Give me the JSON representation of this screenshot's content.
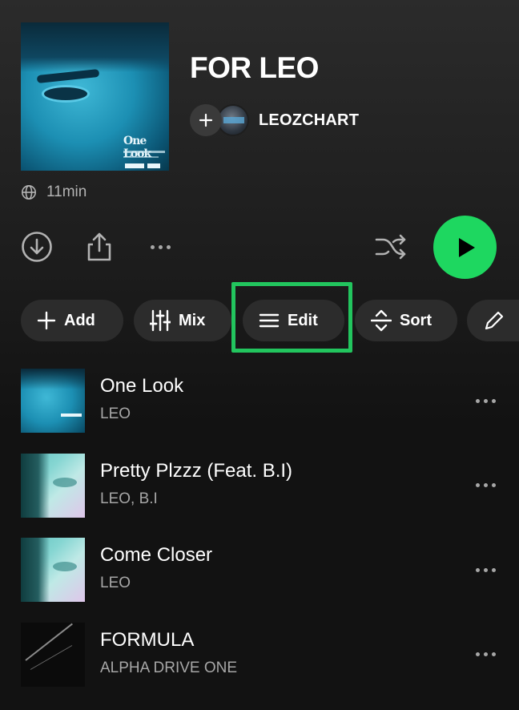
{
  "playlist": {
    "title": "FOR LEO",
    "owner": "LEOZCHART",
    "duration": "11min",
    "cover_icon": "album-cover"
  },
  "actions": {
    "download_icon": "download-icon",
    "share_icon": "share-icon",
    "more_icon": "more-horizontal-icon",
    "shuffle_icon": "shuffle-icon",
    "play_icon": "play-icon",
    "play_color": "#1ed760"
  },
  "chips": [
    {
      "label": "Add",
      "icon": "plus-icon"
    },
    {
      "label": "Mix",
      "icon": "sliders-icon"
    },
    {
      "label": "Edit",
      "icon": "menu-lines-icon",
      "highlighted": true
    },
    {
      "label": "Sort",
      "icon": "sort-arrows-icon"
    },
    {
      "label": "",
      "icon": "pencil-icon"
    }
  ],
  "highlight_color": "#22c55e",
  "tracks": [
    {
      "title": "One Look",
      "artist": "LEO"
    },
    {
      "title": "Pretty Plzzz (Feat. B.I)",
      "artist": "LEO, B.I"
    },
    {
      "title": "Come Closer",
      "artist": "LEO"
    },
    {
      "title": "FORMULA",
      "artist": "ALPHA DRIVE ONE"
    }
  ],
  "cover_text": "One Look"
}
